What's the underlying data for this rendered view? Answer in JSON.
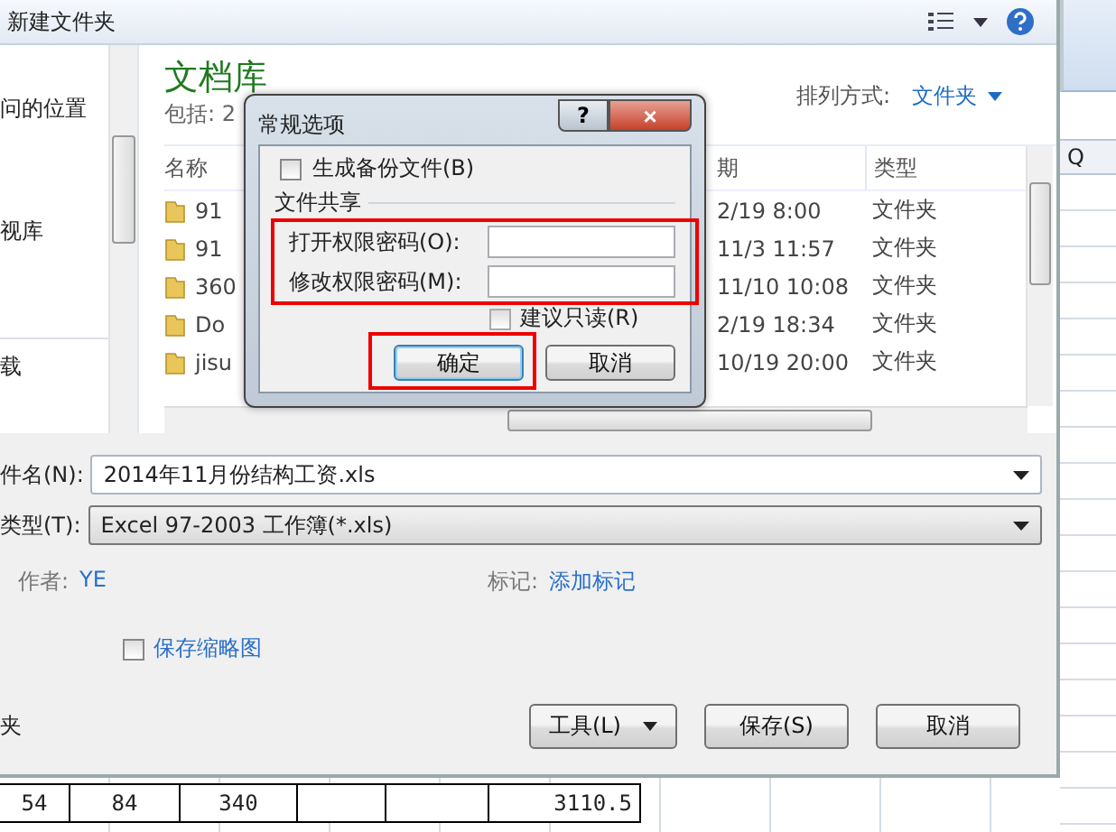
{
  "save_dialog": {
    "toolbar": {
      "new_folder": "新建文件夹"
    },
    "nav_items": [
      {
        "label": "问的位置"
      },
      {
        "label": "视库"
      },
      {
        "label": "载"
      }
    ],
    "library": {
      "title": "文档库",
      "includes": "包括: 2",
      "arrange_label": "排列方式:",
      "arrange_value": "文件夹"
    },
    "columns": [
      "名称",
      "期",
      "类型"
    ],
    "files": [
      {
        "name": "91",
        "date": "2/19 8:00",
        "type": "文件夹"
      },
      {
        "name": "91",
        "date": "11/3 11:57",
        "type": "文件夹"
      },
      {
        "name": "360",
        "date": "11/10 10:08",
        "type": "文件夹"
      },
      {
        "name": "Do",
        "date": "2/19 18:34",
        "type": "文件夹"
      },
      {
        "name": "jisu",
        "date": "10/19 20:00",
        "type": "文件夹"
      }
    ],
    "form": {
      "filename_label": "件名(N):",
      "filename": "2014年11月份结构工资.xls",
      "type_label": "类型(T):",
      "type": "Excel 97-2003 工作簿(*.xls)",
      "author_label": "作者:",
      "author": "YE",
      "tags_label": "标记:",
      "tags": "添加标记",
      "thumbnail": {
        "label": "保存缩略图",
        "checked": false
      },
      "hide_folders": "夹"
    },
    "buttons": {
      "tools": "工具(L)",
      "save": "保存(S)",
      "cancel": "取消"
    }
  },
  "options_dialog": {
    "title": "常规选项",
    "help": "?",
    "close": "×",
    "backup": {
      "label": "生成备份文件(B)",
      "checked": false
    },
    "group": "文件共享",
    "fields": [
      {
        "label": "打开权限密码(O):"
      },
      {
        "label": "修改权限密码(M):"
      }
    ],
    "readonly": {
      "label": "建议只读(R)",
      "checked": false
    },
    "ok": "确定",
    "cancel": "取消"
  },
  "sheet": {
    "column_header": "Q",
    "bottom_row": [
      {
        "kind": "value",
        "text": "54"
      },
      {
        "kind": "value",
        "text": "84"
      },
      {
        "kind": "value",
        "text": "340"
      },
      {
        "kind": "blank"
      },
      {
        "kind": "blank"
      },
      {
        "kind": "value",
        "text": "3110.5"
      }
    ]
  }
}
